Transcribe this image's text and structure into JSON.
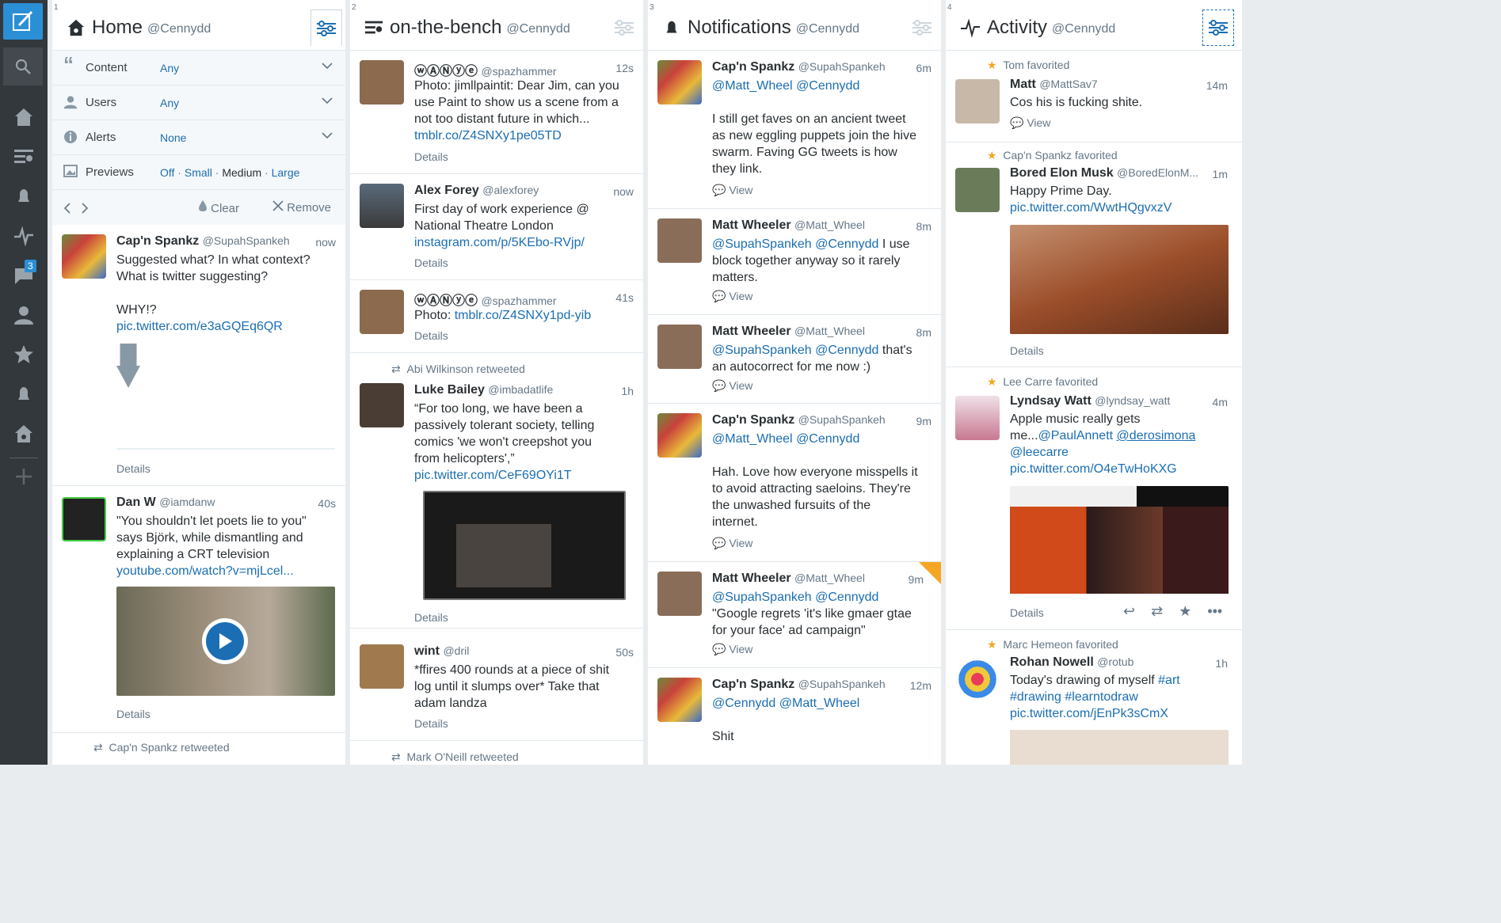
{
  "sidebar": {
    "badge": "3"
  },
  "columns": [
    {
      "num": "1",
      "title": "Home",
      "handle": "@Cennydd",
      "options": {
        "content_label": "Content",
        "content_val": "Any",
        "users_label": "Users",
        "users_val": "Any",
        "alerts_label": "Alerts",
        "alerts_val": "None",
        "previews_label": "Previews",
        "previews_off": "Off",
        "previews_small": "Small",
        "previews_medium": "Medium",
        "previews_large": "Large",
        "clear": "Clear",
        "remove": "Remove"
      },
      "tweets": [
        {
          "name": "Cap'n Spankz",
          "handle": "@SupahSpankeh",
          "time": "now",
          "l1": "Suggested what? In what context?",
          "l2": "What is twitter suggesting?",
          "l3": "WHY!?",
          "link": "pic.twitter.com/e3aGQEq6QR",
          "details": "Details"
        },
        {
          "name": "Dan W",
          "handle": "@iamdanw",
          "time": "40s",
          "l1": "\"You shouldn't let poets lie to you\"",
          "l2": "says Björk, while dismantling and",
          "l3": "explaining a CRT television",
          "link": "youtube.com/watch?v=mjLcel...",
          "details": "Details"
        },
        {
          "rt": "Cap'n Spankz retweeted"
        }
      ]
    },
    {
      "num": "2",
      "title": "on-the-bench",
      "handle": "@Cennydd",
      "tweets": [
        {
          "name": "ⓦⒶⓃⓨⓔ",
          "handle": "@spazhammer",
          "time": "12s",
          "l1": "Photo: jimllpaintit: Dear Jim, can you",
          "l2": "use Paint to show us a scene from a",
          "l3": "not too distant future in which...",
          "link": "tmblr.co/Z4SNXy1pe05TD",
          "details": "Details"
        },
        {
          "name": "Alex Forey",
          "handle": "@alexforey",
          "time": "now",
          "l1": "First day of work experience @",
          "l2": "National Theatre London",
          "link": "instagram.com/p/5KEbo-RVjp/",
          "details": "Details"
        },
        {
          "name": "ⓦⒶⓃⓨⓔ",
          "handle": "@spazhammer",
          "time": "41s",
          "l1": "Photo: ",
          "link": "tmblr.co/Z4SNXy1pd-yib",
          "details": "Details"
        },
        {
          "rt": "Abi Wilkinson retweeted",
          "name": "Luke Bailey",
          "handle": "@imbadatlife",
          "time": "1h",
          "l1": "“For too long, we have been a",
          "l2": "passively tolerant society, telling",
          "l3": "comics 'we won't creepshot you",
          "l4": "from helicopters',”",
          "link": "pic.twitter.com/CeF69OYi1T",
          "details": "Details"
        },
        {
          "name": "wint",
          "handle": "@dril",
          "time": "50s",
          "l1": "*ffires 400 rounds at a piece of shit",
          "l2": "log until it slumps over* Take that",
          "l3": "adam landza",
          "details": "Details"
        },
        {
          "rt": "Mark O'Neill retweeted"
        }
      ]
    },
    {
      "num": "3",
      "title": "Notifications",
      "handle": "@Cennydd",
      "tweets": [
        {
          "name": "Cap'n Spankz",
          "handle": "@SupahSpankeh",
          "time": "6m",
          "m1": "@Matt_Wheel",
          "m2": "@Cennydd",
          "l1": "I still get faves on an ancient tweet",
          "l2": "as new eggling puppets join the hive",
          "l3": "swarm. Faving GG tweets is how",
          "l4": "they link.",
          "view": "View"
        },
        {
          "name": "Matt Wheeler",
          "handle": "@Matt_Wheel",
          "time": "8m",
          "m1": "@SupahSpankeh",
          "m2": "@Cennydd",
          "t1": " I use",
          "l1": "block together anyway so it rarely",
          "l2": "matters.",
          "view": "View"
        },
        {
          "name": "Matt Wheeler",
          "handle": "@Matt_Wheel",
          "time": "8m",
          "m1": "@SupahSpankeh",
          "m2": "@Cennydd",
          "t1": " that's",
          "l1": "an autocorrect for me now :)",
          "view": "View"
        },
        {
          "name": "Cap'n Spankz",
          "handle": "@SupahSpankeh",
          "time": "9m",
          "m1": "@Matt_Wheel",
          "m2": "@Cennydd",
          "l1": "Hah. Love how everyone misspells it",
          "l2": "to avoid attracting saeloins. They're",
          "l3": "the unwashed fursuits of the",
          "l4": "internet.",
          "view": "View"
        },
        {
          "name": "Matt Wheeler",
          "handle": "@Matt_Wheel",
          "time": "9m",
          "m1": "@SupahSpankeh",
          "m2": "@Cennydd",
          "l1": "\"Google regrets 'it's like gmaer gtae",
          "l2": "for your face' ad campaign\"",
          "view": "View"
        },
        {
          "name": "Cap'n Spankz",
          "handle": "@SupahSpankeh",
          "time": "12m",
          "m1": "@Cennydd",
          "m2": "@Matt_Wheel",
          "l1": "Shit"
        }
      ]
    },
    {
      "num": "4",
      "title": "Activity",
      "handle": "@Cennydd",
      "tweets": [
        {
          "fav": "Tom favorited",
          "name": "Matt",
          "handle": "@MattSav7",
          "time": "14m",
          "l1": "Cos his is fucking shite.",
          "view": "View"
        },
        {
          "fav": "Cap'n Spankz favorited",
          "name": "Bored Elon Musk",
          "handle": "@BoredElonM...",
          "time": "1m",
          "l1": "Happy Prime Day.",
          "link": "pic.twitter.com/WwtHQgvxzV",
          "details": "Details"
        },
        {
          "fav": "Lee Carre favorited",
          "name": "Lyndsay Watt",
          "handle": "@lyndsay_watt",
          "time": "4m",
          "l1": "Apple music really gets",
          "l2pre": "me...",
          "m1": "@PaulAnnett",
          "m2": "@derosimona",
          "m3": "@leecarre",
          "link": "pic.twitter.com/O4eTwHoKXG",
          "details": "Details"
        },
        {
          "fav": "Marc Hemeon favorited",
          "name": "Rohan Nowell",
          "handle": "@rotub",
          "time": "1h",
          "l1pre": "Today's drawing of myself ",
          "tag1": "#art",
          "tag2": "#drawing",
          "tag3": "#learntodraw",
          "link": "pic.twitter.com/jEnPk3sCmX"
        }
      ]
    }
  ],
  "colors": {
    "accent": "#1b6eb3",
    "sidebar": "#33383c",
    "compose": "#2b8fd6",
    "star": "#f5a623"
  }
}
